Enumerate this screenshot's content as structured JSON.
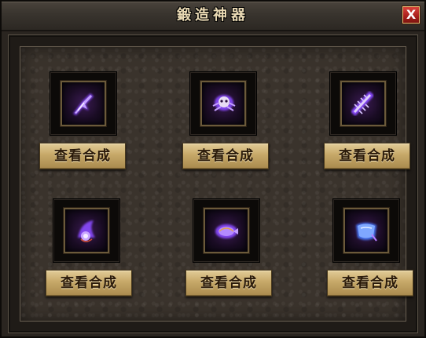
{
  "window": {
    "title": "鍛造神器",
    "close_label": "X"
  },
  "slots": [
    {
      "item_icon": "purple-claw-weapon-icon",
      "button_label": "查看合成"
    },
    {
      "item_icon": "purple-skull-helm-icon",
      "button_label": "查看合成"
    },
    {
      "item_icon": "purple-spine-armor-icon",
      "button_label": "查看合成"
    },
    {
      "item_icon": "purple-orb-amulet-icon",
      "button_label": "查看合成"
    },
    {
      "item_icon": "purple-fish-bracer-icon",
      "button_label": "查看合成"
    },
    {
      "item_icon": "blue-gauntlet-icon",
      "button_label": "查看合成"
    }
  ],
  "colors": {
    "title_text": "#e9d9b4",
    "button_gold": "#c6a868",
    "close_red": "#a81f1a",
    "item_glow_purple": "#8a4cff",
    "item_glow_blue": "#4a7cff"
  }
}
